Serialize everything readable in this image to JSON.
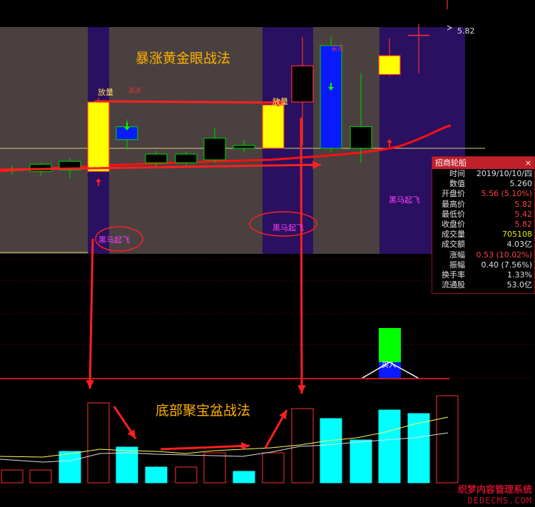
{
  "colors": {
    "background": "#000000",
    "zone_gray": "#4a4040",
    "zone_purple": "#2a1060",
    "candle_yellow": "#ffff00",
    "candle_blue": "#0a1aff",
    "candle_black": "#000000",
    "candle_border_green": "#00c000",
    "candle_border_red": "#ff3030",
    "arrow_red": "#ff2020",
    "vol_cyan": "#00ffff",
    "vol_green": "#00ff00",
    "ma_yellow": "#ffff60",
    "text_gold": "#ffb000",
    "text_magenta": "#ff40ff"
  },
  "chart_data": {
    "type": "candlestick",
    "price_label": "5.82",
    "candles": [
      {
        "i": 0,
        "open": 4.31,
        "close": 4.31,
        "high": 4.34,
        "low": 4.28,
        "style": "doji"
      },
      {
        "i": 1,
        "open": 4.3,
        "close": 4.35,
        "high": 4.36,
        "low": 4.27,
        "style": "black"
      },
      {
        "i": 2,
        "open": 4.31,
        "close": 4.37,
        "high": 4.39,
        "low": 4.25,
        "style": "black"
      },
      {
        "i": 3,
        "open": 4.3,
        "close": 4.78,
        "high": 4.81,
        "low": 4.3,
        "style": "yellow"
      },
      {
        "i": 4,
        "open": 4.61,
        "close": 4.52,
        "high": 4.66,
        "low": 4.45,
        "style": "blue"
      },
      {
        "i": 5,
        "open": 4.36,
        "close": 4.42,
        "high": 4.44,
        "low": 4.33,
        "style": "black"
      },
      {
        "i": 6,
        "open": 4.36,
        "close": 4.42,
        "high": 4.44,
        "low": 4.33,
        "style": "black"
      },
      {
        "i": 7,
        "open": 4.38,
        "close": 4.53,
        "high": 4.6,
        "low": 4.36,
        "style": "black"
      },
      {
        "i": 8,
        "open": 4.46,
        "close": 4.48,
        "high": 4.52,
        "low": 4.43,
        "style": "black"
      },
      {
        "i": 9,
        "open": 4.46,
        "close": 4.76,
        "high": 4.8,
        "low": 4.46,
        "style": "yellow"
      },
      {
        "i": 10,
        "open": 4.78,
        "close": 5.03,
        "high": 5.23,
        "low": 4.48,
        "style": "black"
      },
      {
        "i": 11,
        "open": 5.17,
        "close": 4.46,
        "high": 5.23,
        "low": 4.43,
        "style": "blue"
      },
      {
        "i": 12,
        "open": 4.61,
        "close": 4.46,
        "high": 4.98,
        "low": 4.36,
        "style": "black"
      },
      {
        "i": 13,
        "open": 5.1,
        "close": 4.97,
        "high": 5.22,
        "low": 4.96,
        "style": "yellow"
      },
      {
        "i": 14,
        "open": 5.24,
        "close": 5.24,
        "high": 5.32,
        "low": 4.98,
        "style": "cross"
      },
      {
        "i": 15,
        "open": 5.56,
        "close": 5.82,
        "high": 5.82,
        "low": 5.42,
        "style": "black"
      }
    ],
    "volume": {
      "values": [
        18,
        18,
        44,
        112,
        50,
        22,
        22,
        42,
        16,
        42,
        104,
        90,
        60,
        102,
        97,
        122
      ],
      "styles": [
        "black",
        "black",
        "cyan",
        "black",
        "cyan",
        "cyan",
        "black",
        "black",
        "cyan",
        "black",
        "black",
        "cyan",
        "cyan",
        "cyan",
        "cyan",
        "black"
      ]
    },
    "indicator": {
      "value_green": 1,
      "value_blue": 0.45
    }
  },
  "annotations": {
    "title_top": "暴涨黄金眼战法",
    "title_bottom": "底部聚宝盆战法",
    "fangliang_1": "放量",
    "fangliang_2": "放量",
    "buy_1": "买点",
    "buy_2": "买点",
    "heima_1": "黑马起飞",
    "heima_2": "黑马起飞",
    "heima_3": "黑马起飞",
    "indicator_label": "买入"
  },
  "info_panel": {
    "title": "招商轮船",
    "close_icon": "×",
    "rows": [
      {
        "k": "时间",
        "v": "2019/10/10/四",
        "c": ""
      },
      {
        "k": "数值",
        "v": "5.260",
        "c": ""
      },
      {
        "k": "开盘价",
        "v": "5.56 (5.10%)",
        "c": "red"
      },
      {
        "k": "最高价",
        "v": "5.82",
        "c": "red"
      },
      {
        "k": "最低价",
        "v": "5.42",
        "c": "red"
      },
      {
        "k": "收盘价",
        "v": "5.82",
        "c": "red"
      },
      {
        "k": "成交量",
        "v": "705108",
        "c": "yel"
      },
      {
        "k": "成交额",
        "v": "4.03亿",
        "c": ""
      },
      {
        "k": "涨幅",
        "v": "0.53 (10.02%)",
        "c": "red"
      },
      {
        "k": "振幅",
        "v": "0.40 (7.56%)",
        "c": ""
      },
      {
        "k": "换手率",
        "v": "1.33%",
        "c": ""
      },
      {
        "k": "流通股",
        "v": "53.0亿",
        "c": ""
      }
    ]
  },
  "watermark": {
    "line1": "织梦内容管理系统",
    "line2": "DEDECMS.COM"
  }
}
